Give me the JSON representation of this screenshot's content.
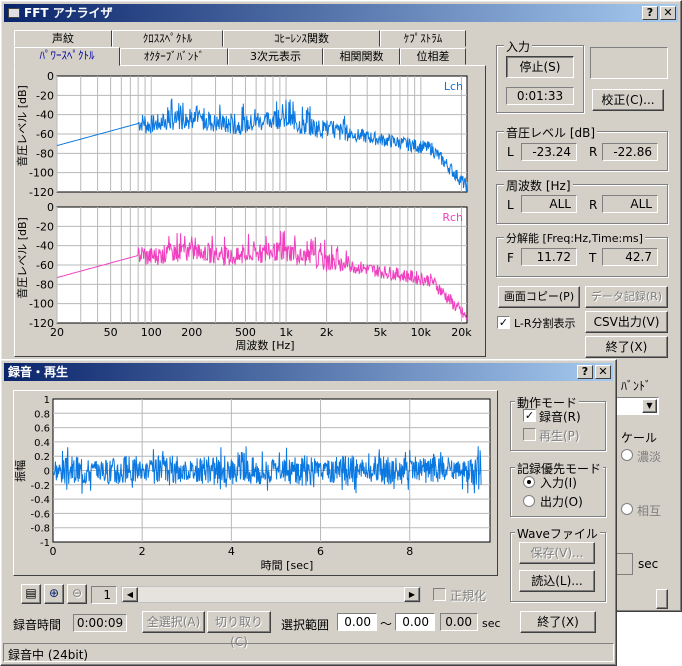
{
  "fft": {
    "title": "FFT アナライザ",
    "tabs_row1": [
      "声紋",
      "ｸﾛｽｽﾍﾟｸﾄﾙ",
      "ｺﾋｰﾚﾝｽ関数",
      "ｹﾌﾟｽﾄﾗﾑ"
    ],
    "tabs_row2": [
      "ﾊﾟﾜｰｽﾍﾟｸﾄﾙ",
      "ｵｸﾀｰﾌﾞﾊﾞﾝﾄﾞ",
      "3次元表示",
      "相関関数",
      "位相差"
    ],
    "lch_label": "Lch",
    "rch_label": "Rch",
    "ylabel": "音圧レベル [dB]",
    "xlabel": "周波数 [Hz]",
    "y_ticks": [
      "0",
      "-20",
      "-40",
      "-60",
      "-80",
      "-100",
      "-120"
    ],
    "x_ticks": [
      "20",
      "50",
      "100",
      "200",
      "500",
      "1k",
      "2k",
      "5k",
      "10k",
      "20k"
    ],
    "input_group": "入力",
    "stop_button": "停止(S)",
    "elapsed": "0:01:33",
    "calibrate_button": "校正(C)...",
    "level_group": "音圧レベル [dB]",
    "level_l_label": "L",
    "level_l_value": "-23.24",
    "level_r_label": "R",
    "level_r_value": "-22.86",
    "freq_group": "周波数 [Hz]",
    "freq_l_label": "L",
    "freq_l_value": "ALL",
    "freq_r_label": "R",
    "freq_r_value": "ALL",
    "res_group": "分解能 [Freq:Hz,Time:ms]",
    "res_f_label": "F",
    "res_f_value": "11.72",
    "res_t_label": "T",
    "res_t_value": "42.7",
    "copy_button": "画面コピー(P)",
    "data_record_button": "データ記録(R)",
    "lr_split_label": "L-R分割表示",
    "csv_button": "CSV出力(V)",
    "close_button": "終了(X)",
    "partial_band": "ﾊﾞﾝﾄﾞ",
    "partial_scale": "ケール",
    "partial_shade": "濃淡",
    "partial_mutual": "相互",
    "partial_sec": "sec"
  },
  "rec": {
    "title": "録音・再生",
    "ylabel": "振幅",
    "xlabel": "時間 [sec]",
    "y_ticks": [
      "1",
      "0.8",
      "0.6",
      "0.4",
      "0.2",
      "0",
      "-0.2",
      "-0.4",
      "-0.6",
      "-0.8",
      "-1"
    ],
    "x_ticks": [
      "0",
      "2",
      "4",
      "6",
      "8"
    ],
    "mode_group": "動作モード",
    "record_label": "録音(R)",
    "play_label": "再生(P)",
    "priority_group": "記録優先モード",
    "input_label": "入力(I)",
    "output_label": "出力(O)",
    "wave_group": "Waveファイル",
    "save_button": "保存(V)...",
    "load_button": "読込(L)...",
    "page_value": "1",
    "normalize_label": "正規化",
    "rec_time_label": "録音時間",
    "rec_time_value": "0:00:09",
    "select_all_button": "全選択(A)",
    "cut_button": "切り取り(C)",
    "range_label": "選択範囲",
    "range_start": "0.00",
    "range_sep": "〜",
    "range_end": "0.00",
    "range_len": "0.00",
    "range_unit": "sec",
    "close_button": "終了(X)",
    "status": "録音中 (24bit)"
  },
  "colors": {
    "lch": "#0a78e0",
    "rch": "#f040c0",
    "wave": "#0a78e0",
    "title_start": "#0a246a",
    "title_end": "#a6caf0"
  }
}
